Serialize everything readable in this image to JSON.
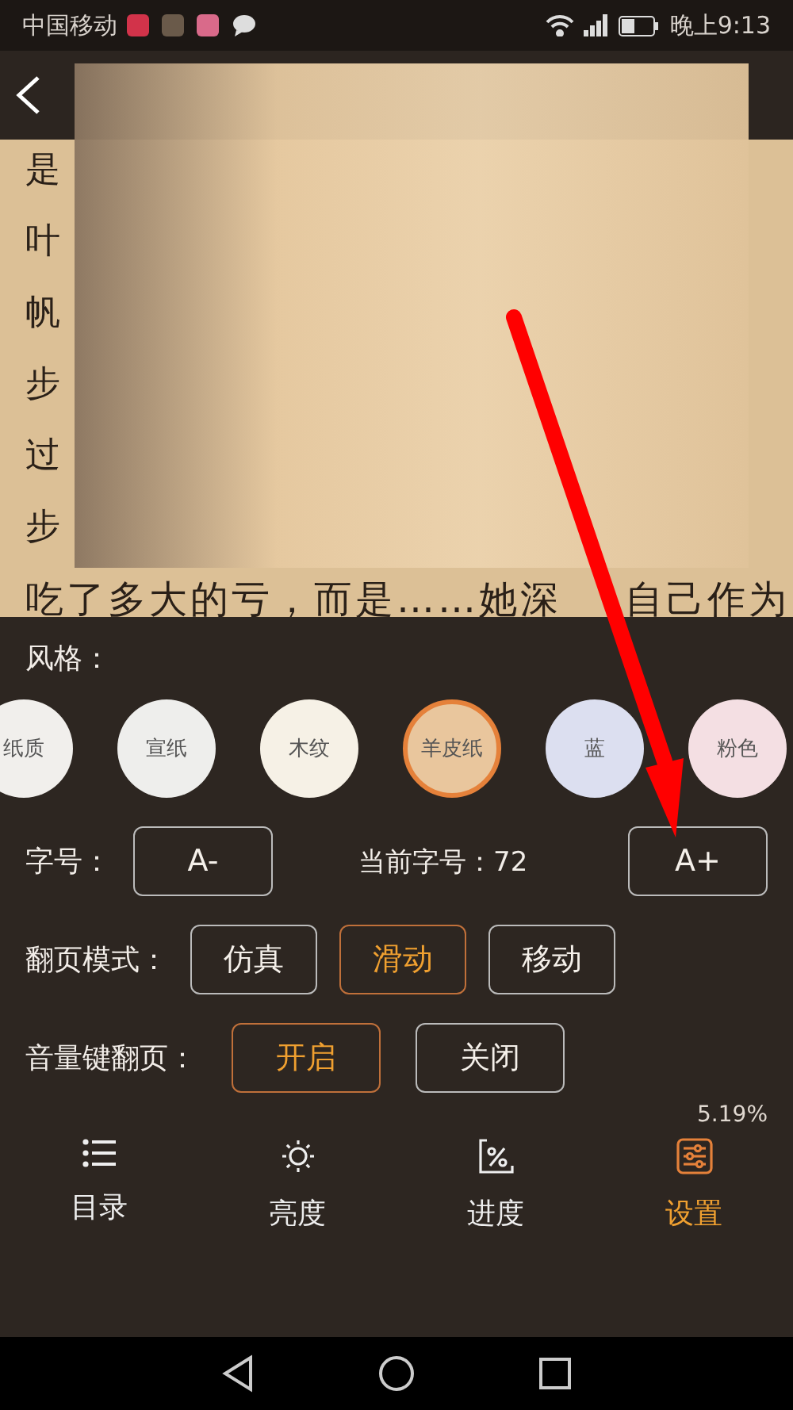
{
  "status_bar": {
    "carrier": "中国移动",
    "time": "晚上9:13"
  },
  "page": {
    "margin_chars": [
      "是",
      "叶",
      "帆",
      "步",
      "过",
      "步"
    ],
    "line_parts": [
      "吃了多大的亏，而是……她深",
      "自己作为"
    ]
  },
  "style_section": {
    "label": "风格：",
    "styles": [
      {
        "label": "纸质",
        "color": "#f1efec",
        "selected": false
      },
      {
        "label": "宣纸",
        "color": "#eeeeec",
        "selected": false
      },
      {
        "label": "木纹",
        "color": "#f6f1e6",
        "selected": false
      },
      {
        "label": "羊皮纸",
        "color": "#e9c69d",
        "selected": true
      },
      {
        "label": "蓝",
        "color": "#dcdff0",
        "selected": false
      },
      {
        "label": "粉色",
        "color": "#f4dfe3",
        "selected": false
      }
    ]
  },
  "font_size": {
    "label": "字号：",
    "decrease": "A-",
    "current": "当前字号：72",
    "increase": "A+"
  },
  "page_mode": {
    "label": "翻页模式：",
    "options": [
      {
        "label": "仿真",
        "selected": false
      },
      {
        "label": "滑动",
        "selected": true
      },
      {
        "label": "移动",
        "selected": false
      }
    ]
  },
  "volume_keys": {
    "label": "音量键翻页：",
    "options": [
      {
        "label": "开启",
        "selected": true
      },
      {
        "label": "关闭",
        "selected": false
      }
    ]
  },
  "progress": "5.19%",
  "bottom_nav": [
    {
      "kind": "list",
      "label": "目录",
      "selected": false
    },
    {
      "kind": "sun",
      "label": "亮度",
      "selected": false
    },
    {
      "kind": "percent",
      "label": "进度",
      "selected": false
    },
    {
      "kind": "sliders",
      "label": "设置",
      "selected": true
    }
  ]
}
